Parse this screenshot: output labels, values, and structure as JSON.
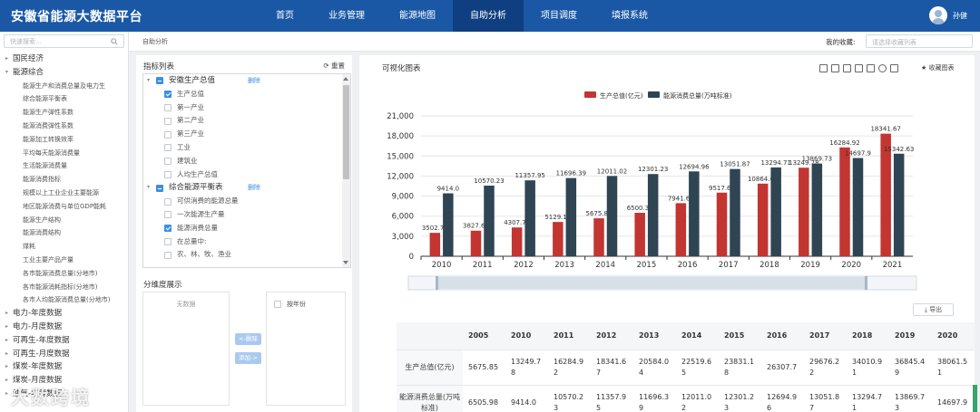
{
  "app": {
    "title": "安徽省能源大数据平台",
    "user": "孙健"
  },
  "nav": [
    "首页",
    "业务管理",
    "能源地图",
    "自助分析",
    "项目调度",
    "填报系统"
  ],
  "sidebar": {
    "search_placeholder": "快速搜索...",
    "items": [
      {
        "level": 1,
        "label": "国民经济"
      },
      {
        "level": 1,
        "label": "能源综合",
        "open": true
      },
      {
        "level": 2,
        "label": "能源生产和消费总量及电力生"
      },
      {
        "level": 2,
        "label": "综合能源平衡表"
      },
      {
        "level": 2,
        "label": "能源生产弹性系数"
      },
      {
        "level": 2,
        "label": "能源消费弹性系数"
      },
      {
        "level": 2,
        "label": "能源加工转换效率"
      },
      {
        "level": 2,
        "label": "平均每天能源消费量"
      },
      {
        "level": 2,
        "label": "生活能源消费量"
      },
      {
        "level": 2,
        "label": "能源消费指标"
      },
      {
        "level": 2,
        "label": "规模以上工业企业主要能源"
      },
      {
        "level": 2,
        "label": "地区能源消费与单位GDP能耗"
      },
      {
        "level": 2,
        "label": "能源生产结构"
      },
      {
        "level": 2,
        "label": "能源消费结构"
      },
      {
        "level": 2,
        "label": "煤耗"
      },
      {
        "level": 2,
        "label": "工业主要产品产量"
      },
      {
        "level": 2,
        "label": "各市能源消费总量(分地市)"
      },
      {
        "level": 2,
        "label": "各市能源消耗指标(分地市)"
      },
      {
        "level": 2,
        "label": "各市人均能源消费总量(分地市)"
      },
      {
        "level": 1,
        "label": "电力-年度数据"
      },
      {
        "level": 1,
        "label": "电力-月度数据"
      },
      {
        "level": 1,
        "label": "可再生-年度数据"
      },
      {
        "level": 1,
        "label": "可再生-月度数据"
      },
      {
        "level": 1,
        "label": "煤炭-年度数据"
      },
      {
        "level": 1,
        "label": "煤炭-月度数据"
      },
      {
        "level": 1,
        "label": "油气-年度数据"
      }
    ]
  },
  "breadcrumb": "自助分析",
  "favorites": {
    "label": "我的收藏:",
    "placeholder": "请选择收藏列表"
  },
  "indicator_panel": {
    "title": "指标列表",
    "reset": "重置",
    "delete_label": "删除",
    "rows": [
      {
        "type": "group",
        "label": "安徽生产总值",
        "state": "part",
        "del": true
      },
      {
        "type": "item",
        "label": "生产总值",
        "state": "on"
      },
      {
        "type": "item",
        "label": "第一产业",
        "state": "off"
      },
      {
        "type": "item",
        "label": "第二产业",
        "state": "off"
      },
      {
        "type": "item",
        "label": "第三产业",
        "state": "off"
      },
      {
        "type": "item",
        "label": "工业",
        "state": "off"
      },
      {
        "type": "item",
        "label": "建筑业",
        "state": "off"
      },
      {
        "type": "item",
        "label": "人均生产总值",
        "state": "off"
      },
      {
        "type": "group",
        "label": "综合能源平衡表",
        "state": "part",
        "del": true
      },
      {
        "type": "item",
        "label": "可供消费的能源总量",
        "state": "off"
      },
      {
        "type": "item",
        "label": "一次能源生产量",
        "state": "off"
      },
      {
        "type": "item",
        "label": "能源消费总量",
        "state": "on"
      },
      {
        "type": "item",
        "label": "在总量中:",
        "state": "off"
      },
      {
        "type": "item",
        "label": "农、林、牧、渔业",
        "state": "off"
      }
    ]
  },
  "dimension_panel": {
    "title": "分维度展示",
    "empty": "无数据",
    "by_year": "按年份",
    "btn_remove": "<-删除",
    "btn_add": "添加->"
  },
  "chart_panel": {
    "title": "可视化图表",
    "save": "收藏图表",
    "tool_icons": [
      "zoom-icon",
      "zoom-reset-icon",
      "data-view-icon",
      "line-chart-icon",
      "bar-chart-icon",
      "refresh-icon",
      "download-icon"
    ],
    "export": "导出"
  },
  "chart_data": {
    "type": "bar",
    "categories": [
      "2010",
      "2011",
      "2012",
      "2013",
      "2014",
      "2015",
      "2016",
      "2017",
      "2018",
      "2019",
      "2020",
      "2021"
    ],
    "series": [
      {
        "name": "生产总值(亿元)",
        "color": "#c23531",
        "values": [
          3502.78,
          3827.66,
          4307.77,
          5129.12,
          5675.85,
          6500.31,
          7941.61,
          9517.66,
          10864.66,
          13249.78,
          16284.92,
          18341.67
        ]
      },
      {
        "name": "能源消费总量(万吨标准)",
        "color": "#2f4554",
        "values": [
          9414.0,
          10570.23,
          11357.95,
          11696.39,
          12011.02,
          12301.23,
          12694.96,
          13051.87,
          13294.71,
          13869.73,
          14697.9,
          15342.63
        ]
      }
    ],
    "labels": {
      "s0": [
        "3502.78",
        "3827.66",
        "4307.77",
        "5129.12",
        "5675.85",
        "6500.31",
        "7941.61",
        "9517.66",
        "10864.66",
        "13249.78",
        "16284.92",
        "18341.67"
      ],
      "s1": [
        "9414.0",
        "10570.23",
        "11357.95",
        "11696.39",
        "12011.02",
        "12301.23",
        "12694.96",
        "13051.87",
        "13294.71",
        "13869.73",
        "14697.9",
        "15342.63"
      ]
    },
    "ylim": [
      0,
      21000
    ],
    "yticks": [
      "0",
      "3,000",
      "6,000",
      "9,000",
      "12,000",
      "15,000",
      "18,000",
      "21,000"
    ],
    "legend": "top-center",
    "grid": true
  },
  "table": {
    "headers": [
      "",
      "2005",
      "2010",
      "2011",
      "2012",
      "2013",
      "2014",
      "2015",
      "2016",
      "2017",
      "2018",
      "2019",
      "2020"
    ],
    "rows": [
      {
        "name": "生产总值(亿元)",
        "values": [
          "5675.85",
          "13249.78",
          "16284.92",
          "18341.67",
          "20584.04",
          "22519.65",
          "23831.18",
          "26307.7",
          "29676.22",
          "34010.91",
          "36845.49",
          "38061.51"
        ]
      },
      {
        "name": "能源消费总量(万吨标准)",
        "values": [
          "6505.98",
          "9414.0",
          "10570.23",
          "11357.95",
          "11696.39",
          "12011.02",
          "12301.23",
          "12694.96",
          "13051.87",
          "13294.71",
          "13869.73",
          "14697.9"
        ]
      }
    ]
  },
  "watermark": "大数跨境"
}
